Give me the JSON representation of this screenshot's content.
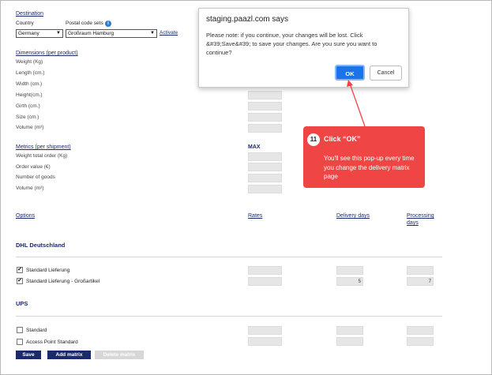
{
  "destination": {
    "title": "Destination",
    "country_label": "Country",
    "postal_label": "Postal code sets",
    "country_value": "Germany",
    "postal_value": "Großraum Hamburg",
    "activate_link": "Activate"
  },
  "dimensions": {
    "title": "Dimensions (per product)",
    "fields": [
      "Weight (Kg)",
      "Length (cm.)",
      "Width (cm.)",
      "Height(cm.)",
      "Girth (cm.)",
      "Size (cm.)",
      "Volume (m³)"
    ]
  },
  "metrics": {
    "title": "Metrics (per shipment)",
    "max_label": "MAX",
    "fields": [
      "Weight total order (Kg)",
      "Order value (€)",
      "Number of goods",
      "Volume (m³)"
    ]
  },
  "options_header": {
    "options": "Options",
    "rates": "Rates",
    "delivery_days": "Delivery days",
    "processing_days_line1": "Processing",
    "processing_days_line2": "days"
  },
  "carriers": [
    {
      "name": "DHL Deutschland",
      "services": [
        {
          "label": "Standard Lieferung",
          "checked": "✔",
          "delivery": "",
          "processing": ""
        },
        {
          "label": "Standard Lieferung - Großartikel",
          "checked": "✔",
          "delivery": "5",
          "processing": "7"
        }
      ]
    },
    {
      "name": "UPS",
      "services": [
        {
          "label": "Standard",
          "checked": "",
          "delivery": "",
          "processing": ""
        },
        {
          "label": "Access Point Standard",
          "checked": "",
          "delivery": "",
          "processing": ""
        }
      ]
    }
  ],
  "buttons": {
    "save": "Save",
    "add_matrix": "Add matrix",
    "delete_matrix": "Delete matrix"
  },
  "dialog": {
    "title": "staging.paazl.com says",
    "message": "Please note: if you continue, your changes will be lost. Click &#39;Save&#39; to save your changes. Are you sure you want to continue?",
    "ok": "OK",
    "cancel": "Cancel"
  },
  "callout": {
    "step": "11",
    "title": "Click “OK”",
    "body": "You'll see this pop-up every time you change the delivery matrix page",
    "color": "#f04545"
  },
  "icons": {
    "info": "i",
    "dropdown": "▼"
  }
}
